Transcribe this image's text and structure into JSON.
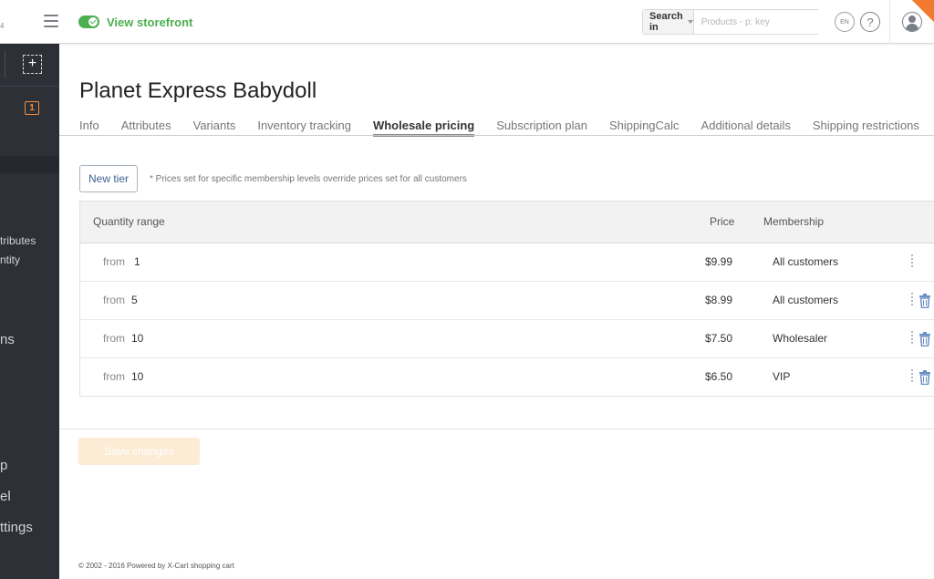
{
  "topbar": {
    "left_fragment": "4",
    "storefront_label": "View storefront",
    "search_in_label": "Search in",
    "search_placeholder": "Products - p: key",
    "lang": "EN",
    "help": "?"
  },
  "sidebar": {
    "add_symbol": "+",
    "badge": "1",
    "items": [
      "tributes",
      "ntity",
      "ns",
      "p",
      "el",
      "ttings"
    ]
  },
  "page": {
    "title": "Planet Express Babydoll",
    "tabs": [
      {
        "label": "Info",
        "active": false
      },
      {
        "label": "Attributes",
        "active": false
      },
      {
        "label": "Variants",
        "active": false
      },
      {
        "label": "Inventory tracking",
        "active": false
      },
      {
        "label": "Wholesale pricing",
        "active": true
      },
      {
        "label": "Subscription plan",
        "active": false
      },
      {
        "label": "ShippingCalc",
        "active": false
      },
      {
        "label": "Additional details",
        "active": false
      },
      {
        "label": "Shipping restrictions",
        "active": false
      }
    ]
  },
  "pricing": {
    "new_tier_label": "New tier",
    "note": "* Prices set for specific membership levels override prices set for all customers",
    "columns": {
      "quantity": "Quantity range",
      "price": "Price",
      "membership": "Membership"
    },
    "rows": [
      {
        "from": "from",
        "qty": "1",
        "price": "$9.99",
        "membership": "All customers",
        "deletable": false
      },
      {
        "from": "from",
        "qty": "5",
        "price": "$8.99",
        "membership": "All customers",
        "deletable": true
      },
      {
        "from": "from",
        "qty": "10",
        "price": "$7.50",
        "membership": "Wholesaler",
        "deletable": true
      },
      {
        "from": "from",
        "qty": "10",
        "price": "$6.50",
        "membership": "VIP",
        "deletable": true
      }
    ],
    "save_label": "Save changes"
  },
  "footer": {
    "copyright": "© 2002 - 2016 Powered by X-Cart shopping cart"
  },
  "colors": {
    "accent_green": "#4caf50",
    "sidebar_bg": "#2d3037",
    "badge_orange": "#f0913a",
    "link_blue": "#3e6391"
  }
}
